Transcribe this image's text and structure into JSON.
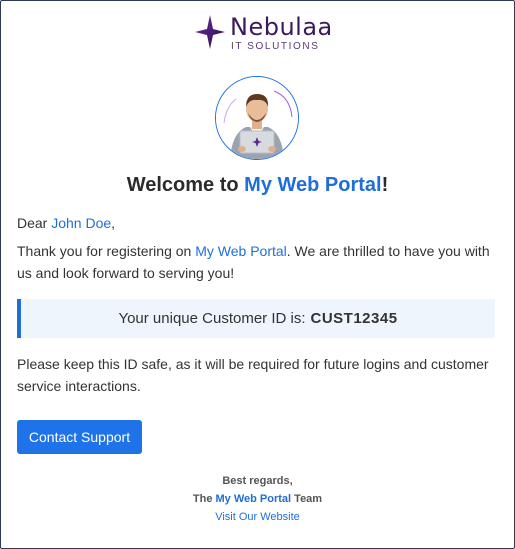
{
  "logo": {
    "brand": "Nebulaa",
    "tagline": "IT SOLUTIONS"
  },
  "heading": {
    "prefix": "Welcome to ",
    "portal": "My Web Portal",
    "suffix": "!"
  },
  "greeting": {
    "prefix": "Dear ",
    "name": "John Doe",
    "suffix": ","
  },
  "intro": {
    "prefix": "Thank you for registering on ",
    "portal": "My Web Portal",
    "suffix": ". We are thrilled to have you with us and look forward to serving you!"
  },
  "customer_id": {
    "label": "Your unique Customer ID is:",
    "value": "CUST12345"
  },
  "notice": "Please keep this ID safe, as it will be required for future logins and customer service interactions.",
  "contact_button": "Contact Support",
  "footer": {
    "regards": "Best regards,",
    "team_prefix": "The ",
    "team_name": "My Web Portal",
    "team_suffix": " Team",
    "website_link": "Visit Our Website"
  },
  "colors": {
    "accent": "#1e6fd8",
    "button": "#1e73e8",
    "brand": "#3b1a5c",
    "id_box_bg": "#eef5fc"
  }
}
